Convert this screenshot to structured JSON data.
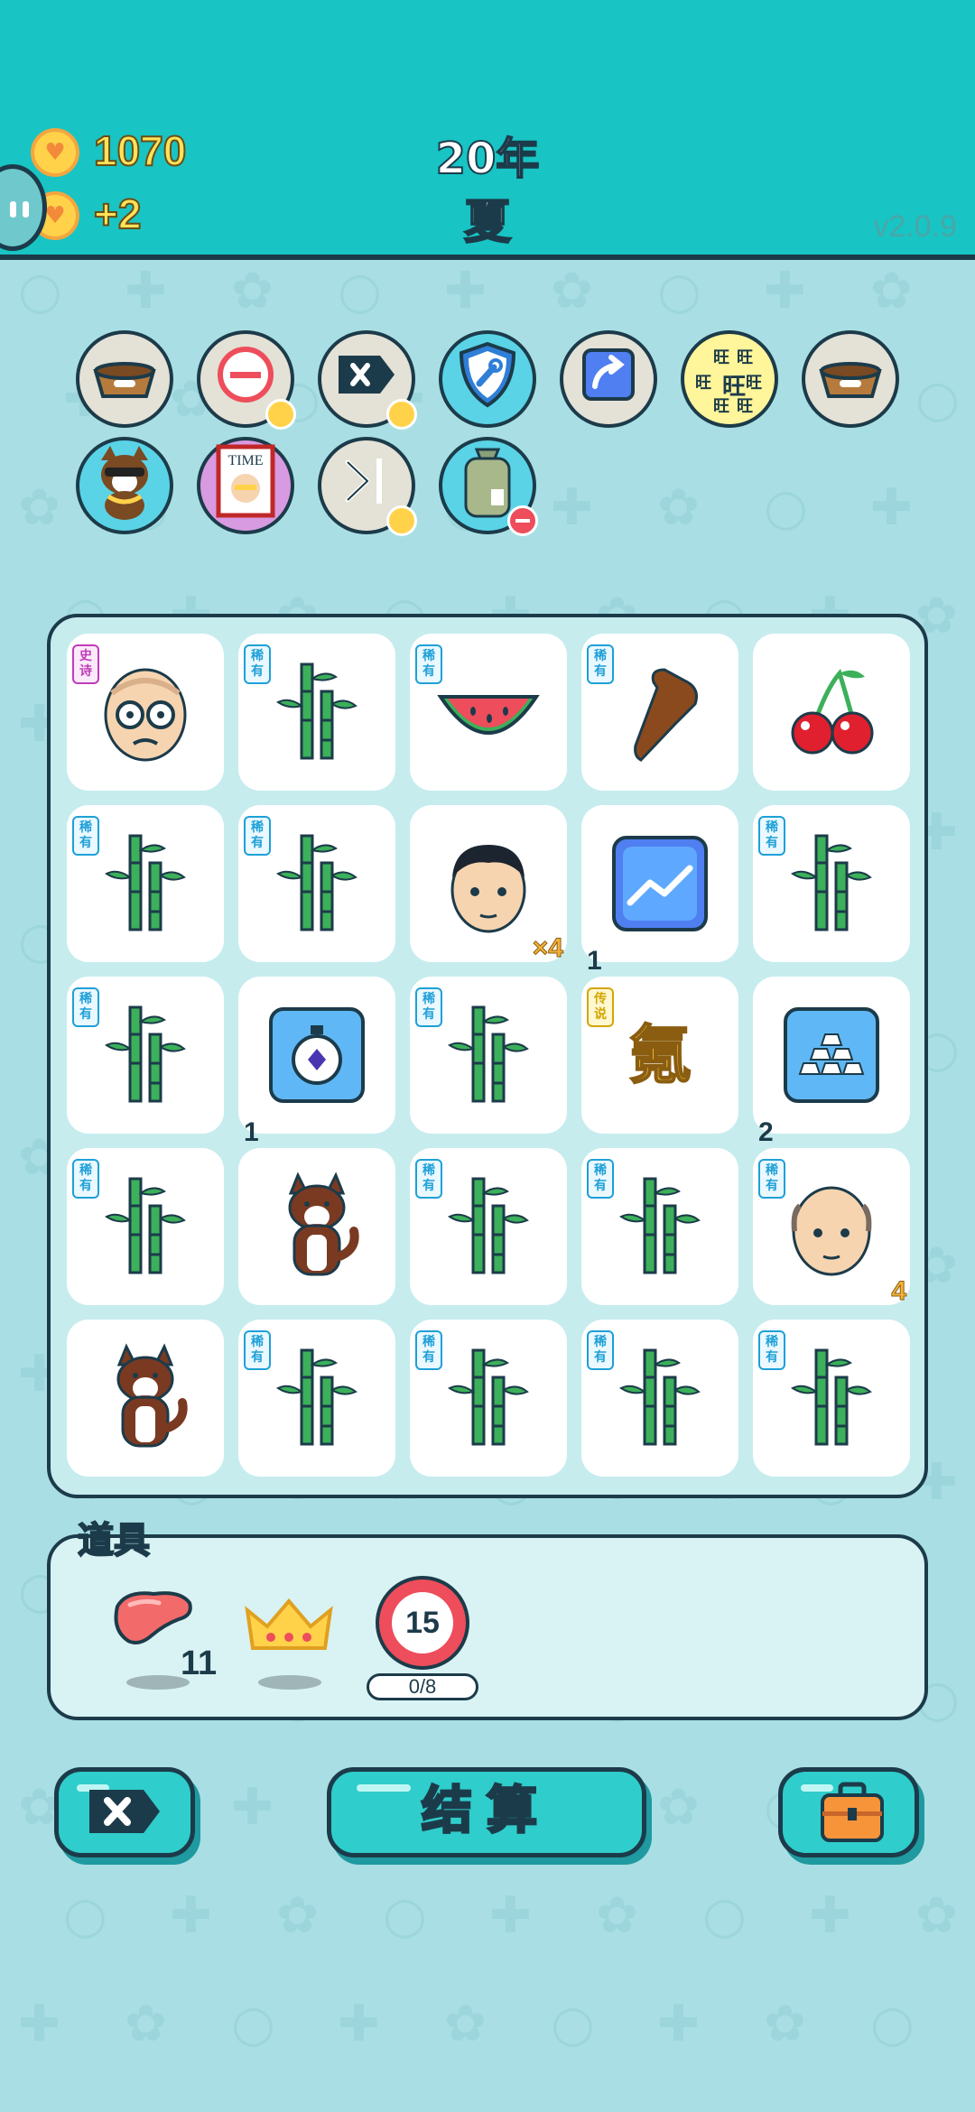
{
  "header": {
    "coins": "1070",
    "income": "+2",
    "year": "20年",
    "season": "夏",
    "version": "v2.0.9"
  },
  "effects": [
    {
      "name": "pet-food-bowl-icon",
      "bg": "#e4e1d6"
    },
    {
      "name": "minus-circle-icon",
      "bg": "#e4e1d6",
      "badge": "coin"
    },
    {
      "name": "delete-tag-icon",
      "bg": "#e4e1d6",
      "badge": "coin"
    },
    {
      "name": "shield-wrench-icon",
      "bg": "#5ad3e6"
    },
    {
      "name": "arrow-up-card-icon",
      "bg": "#e4e1d6"
    },
    {
      "name": "wang-text-icon",
      "bg": "#fff59a",
      "text": "旺"
    },
    {
      "name": "pet-food-bowl-icon",
      "bg": "#e4e1d6"
    },
    {
      "name": "cool-dog-icon",
      "bg": "#5ad3e6"
    },
    {
      "name": "time-magazine-icon",
      "bg": "#d89ae0",
      "text": "TIME"
    },
    {
      "name": "skip-icon",
      "bg": "#e4e1d6",
      "badge": "coin"
    },
    {
      "name": "sack-icon",
      "bg": "#5ad3e6",
      "badge": "remove"
    }
  ],
  "board": {
    "cells": [
      {
        "symbol": "old-man-glasses",
        "rarity": "史诗",
        "tier": "epic"
      },
      {
        "symbol": "bamboo",
        "rarity": "稀有",
        "tier": "rare"
      },
      {
        "symbol": "watermelon",
        "rarity": "稀有",
        "tier": "rare"
      },
      {
        "symbol": "pointing-hand",
        "rarity": "稀有",
        "tier": "rare"
      },
      {
        "symbol": "cherry"
      },
      {
        "symbol": "bamboo",
        "rarity": "稀有",
        "tier": "rare"
      },
      {
        "symbol": "bamboo",
        "rarity": "稀有",
        "tier": "rare"
      },
      {
        "symbol": "man-face",
        "mult": "×4"
      },
      {
        "symbol": "trend-chart",
        "count": "1"
      },
      {
        "symbol": "bamboo",
        "rarity": "稀有",
        "tier": "rare"
      },
      {
        "symbol": "bamboo",
        "rarity": "稀有",
        "tier": "rare"
      },
      {
        "symbol": "stopwatch",
        "count": "1"
      },
      {
        "symbol": "bamboo",
        "rarity": "稀有",
        "tier": "rare"
      },
      {
        "symbol": "krypton",
        "rarity": "传说",
        "tier": "legend",
        "text": "氪"
      },
      {
        "symbol": "gold-bars",
        "count": "2"
      },
      {
        "symbol": "bamboo",
        "rarity": "稀有",
        "tier": "rare"
      },
      {
        "symbol": "husky"
      },
      {
        "symbol": "bamboo",
        "rarity": "稀有",
        "tier": "rare"
      },
      {
        "symbol": "bamboo",
        "rarity": "稀有",
        "tier": "rare"
      },
      {
        "symbol": "bald-man",
        "rarity": "稀有",
        "tier": "rare",
        "mult": "4"
      },
      {
        "symbol": "husky"
      },
      {
        "symbol": "bamboo",
        "rarity": "稀有",
        "tier": "rare"
      },
      {
        "symbol": "bamboo",
        "rarity": "稀有",
        "tier": "rare"
      },
      {
        "symbol": "bamboo",
        "rarity": "稀有",
        "tier": "rare"
      },
      {
        "symbol": "bamboo",
        "rarity": "稀有",
        "tier": "rare"
      }
    ]
  },
  "items": {
    "title": "道具",
    "liver_count": "11",
    "timer_value": "15",
    "timer_progress": "0/8"
  },
  "buttons": {
    "settle": "结算"
  }
}
